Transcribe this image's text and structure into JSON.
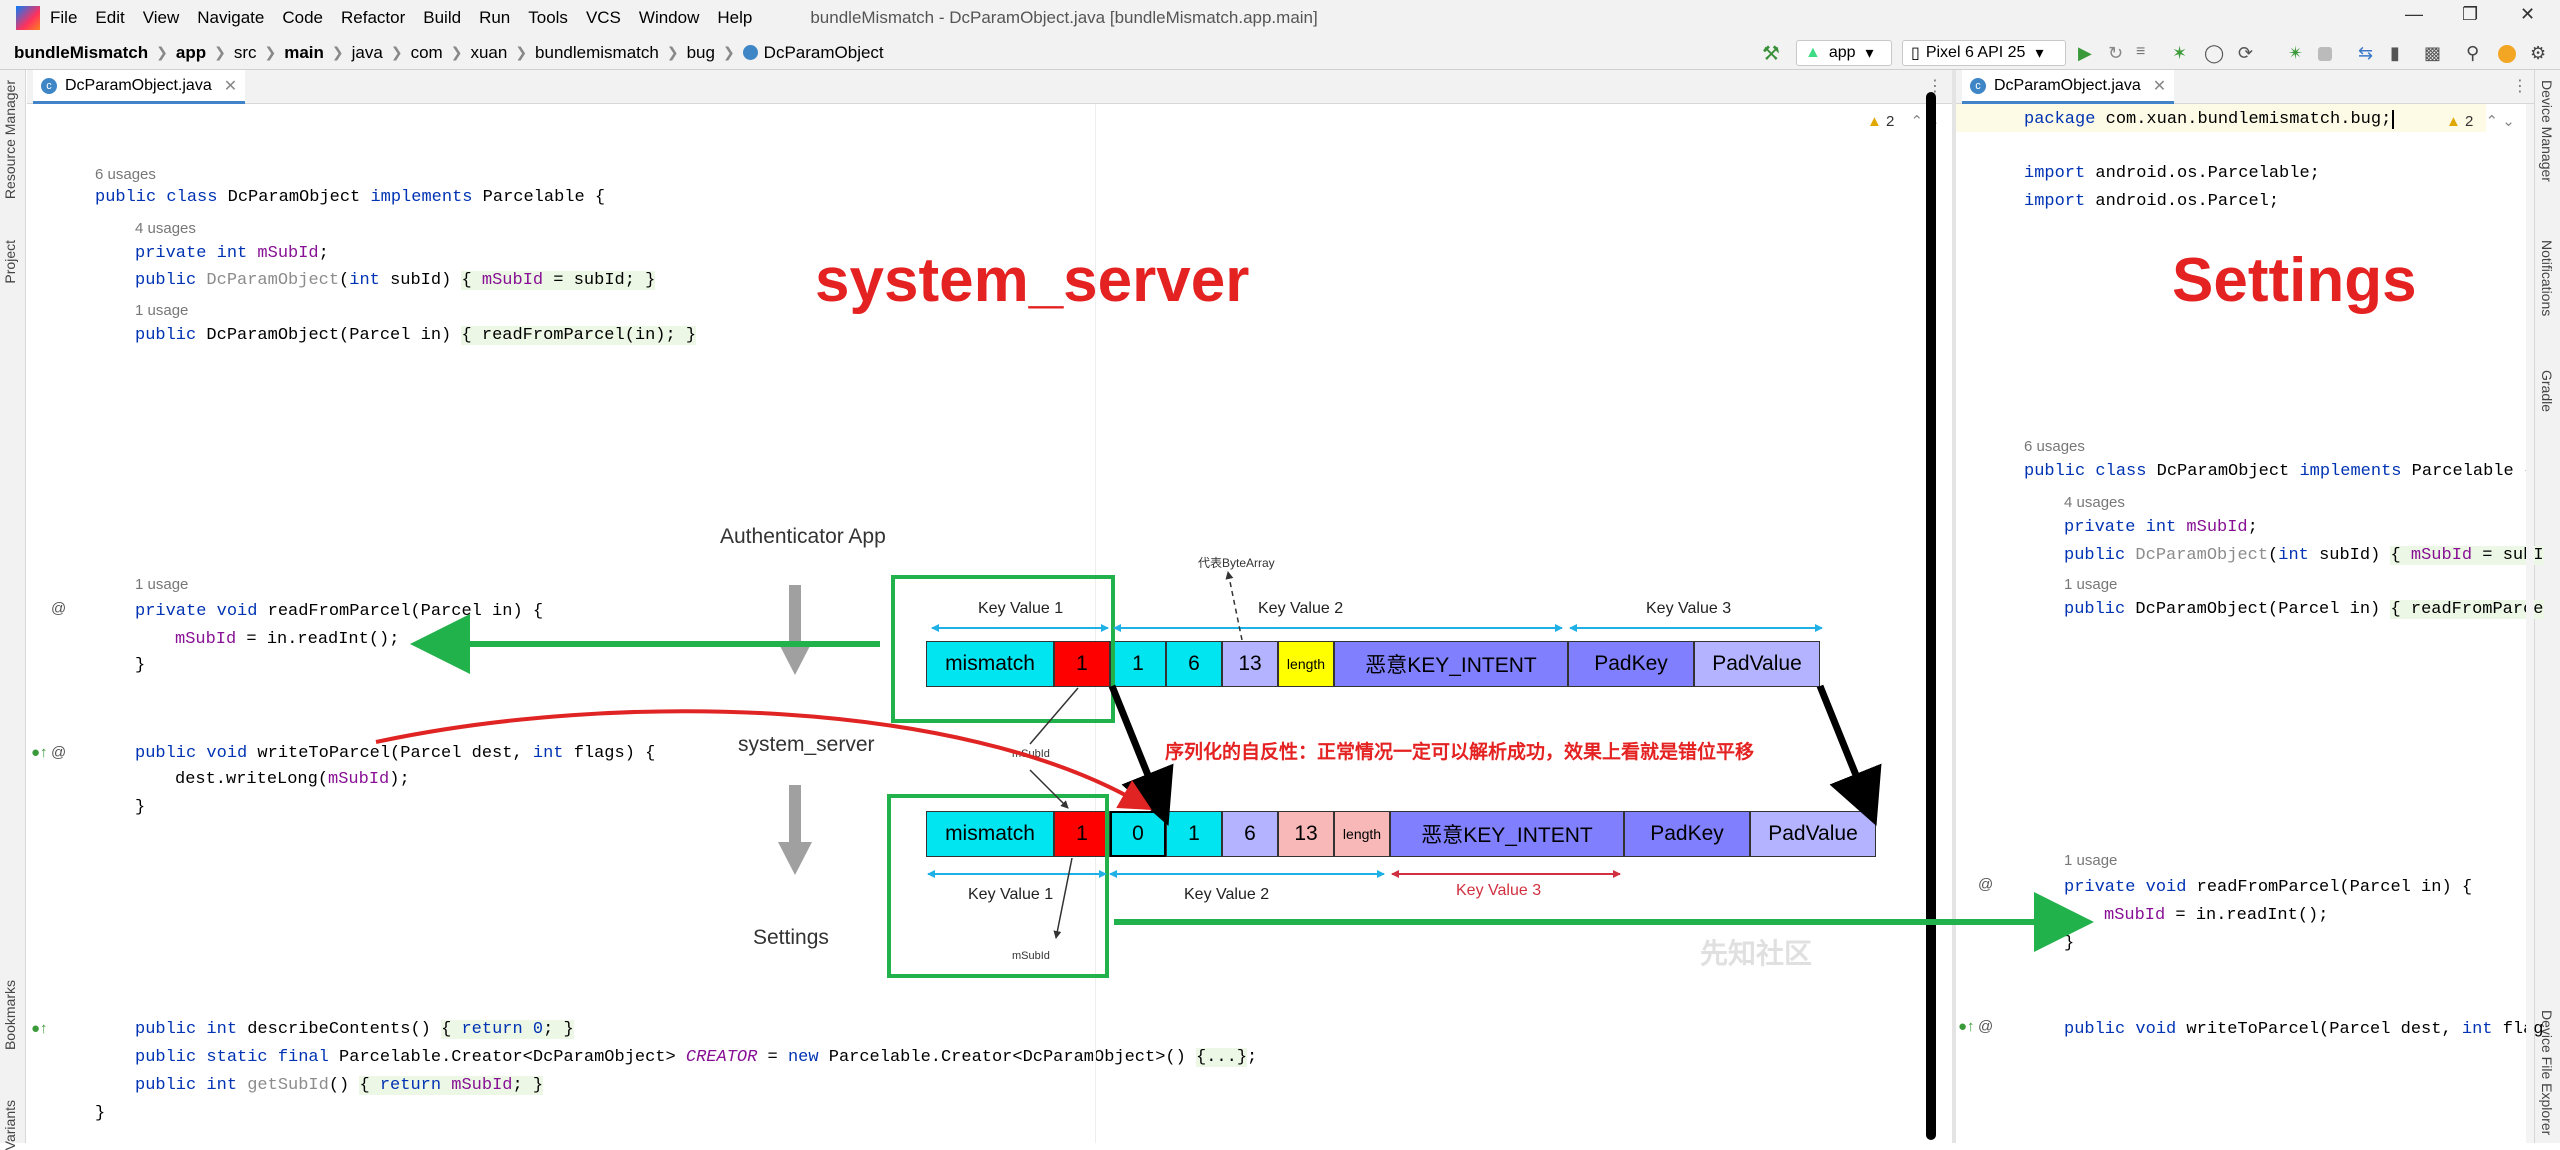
{
  "menubar": {
    "items": [
      "File",
      "Edit",
      "View",
      "Navigate",
      "Code",
      "Refactor",
      "Build",
      "Run",
      "Tools",
      "VCS",
      "Window",
      "Help"
    ],
    "title": "bundleMismatch - DcParamObject.java [bundleMismatch.app.main]"
  },
  "navbar": {
    "crumbs": [
      "bundleMismatch",
      "app",
      "src",
      "main",
      "java",
      "com",
      "xuan",
      "bundlemismatch",
      "bug",
      "DcParamObject"
    ],
    "run_config": "app",
    "device": "Pixel 6 API 25"
  },
  "left_strip": {
    "resource_manager": "Resource Manager",
    "project": "Project",
    "bookmarks": "Bookmarks",
    "variants": "Variants"
  },
  "right_strip": {
    "device_manager": "Device Manager",
    "notifications": "Notifications",
    "gradle": "Gradle",
    "device_file_explorer": "Device File Explorer"
  },
  "tabs": {
    "left": "DcParamObject.java",
    "right": "DcParamObject.java"
  },
  "warnings": {
    "left": "2",
    "right": "2"
  },
  "left_code": {
    "usages_6": "6 usages",
    "usages_4": "4 usages",
    "usages_1a": "1 usage",
    "usages_1b": "1 usage",
    "l_class_kw": "public class ",
    "l_class_name": "DcParamObject ",
    "l_class_impl": "implements ",
    "l_class_rest": "Parcelable {",
    "l_field_kw": "private int ",
    "l_field_name": "mSubId",
    ";": ";",
    "l_ctor1_kw": "public ",
    "l_ctor1_name": "DcParamObject",
    "l_ctor1_p": "(",
    "l_ctor1_int": "int ",
    "l_ctor1_rest": "subId) ",
    "l_ctor1_body": "{ ",
    "l_ctor1_fld": "mSubId",
    " l_ctor1_tail": " = subId; }",
    "l_ctor2_kw": "public ",
    "l_ctor2_rest": "DcParamObject(Parcel in) ",
    "l_ctor2_body": "{ readFromParcel(in); }",
    "l_read_kw": "private void ",
    "l_read_rest": "readFromParcel(Parcel in) {",
    "l_read_body_fld": "mSubId",
    "l_read_body_rest": " = in.readInt();",
    "close": "}",
    "l_write_kw": "public void ",
    "l_write_rest": "writeToParcel(Parcel dest, ",
    "l_write_int": "int ",
    "l_write_tail": "flags) {",
    "l_write_body": "dest.writeLong(",
    "l_write_body_fld": "mSubId",
    "l_write_body_tail": ");",
    "l_desc_kw": "public int ",
    "l_desc_rest": "describeContents() ",
    "l_desc_body": "{ ",
    "l_desc_ret": "return ",
    "l_desc_num": "0",
    "l_desc_tail": "; }",
    "l_creator_kw": "public static final ",
    "l_creator_type": "Parcelable.Creator<DcParamObject> ",
    "l_creator_name": "CREATOR",
    " l_creator_eq": " = ",
    "l_creator_new": "new ",
    "l_creator_rest": "Parcelable.Creator<DcParamObject>() ",
    "l_creator_fold": "{...}",
    "l_creator_tail": ";",
    "l_get_kw": "public int ",
    "l_get_name": "getSubId",
    "l_get_p": "() ",
    "l_get_body": "{ ",
    "l_get_ret": "return ",
    "l_get_fld": "mSubId",
    "l_get_tail": "; }",
    "last": "}"
  },
  "right_code": {
    "package_kw": "package ",
    "package_rest": "com.xuan.bundlemismatch.bug;",
    "import1_kw": "import ",
    "import1_rest": "android.os.Parcelable;",
    "import2_kw": "import ",
    "import2_rest": "android.os.Parcel;",
    "usages_6": "6 usages",
    "usages_4": "4 usages",
    "usages_1a": "1 usage",
    "usages_1b": "1 usage",
    "class_kw": "public class ",
    "class_rest": "DcParamObject ",
    "class_impl": "implements ",
    "class_tail": "Parcelable {",
    "field_kw": "private int ",
    "field_name": "mSubId",
    "field_tail": ";",
    "ctor1_kw": "public ",
    "ctor1_name": "DcParamObject",
    "ctor1_p": "(",
    "ctor1_int": "int ",
    "ctor1_rest": "subId) ",
    "ctor1_body": "{ ",
    "ctor1_fld": "mSubId",
    "ctor1_tail": " = subI",
    "ctor2_kw": "public ",
    "ctor2_rest": "DcParamObject(Parcel in) ",
    "ctor2_body": "{ readFromParce",
    "read_kw": "private void ",
    "read_rest": "readFromParcel(Parcel in) {",
    "read_fld": "mSubId",
    "read_tail": " = in.readInt();",
    "close": "}",
    "write_kw": "public void ",
    "write_rest": "writeToParcel(Parcel dest, ",
    "write_int": "int ",
    "write_tail": "flag"
  },
  "overlay": {
    "system_server_title": "system_server",
    "settings_title": "Settings",
    "authenticator_app": "Authenticator App",
    "system_server_label": "system_server",
    "settings_label": "Settings",
    "bytearray_note": "代表ByteArray",
    "msubid_mid": "mSubId",
    "msubid_bottom": "mSubId",
    "caption": "序列化的自反性：正常情况一定可以解析成功，效果上看就是错位平移",
    "watermark": "先知社区",
    "row1": {
      "kv1": "Key Value 1",
      "kv2": "Key Value 2",
      "kv3": "Key Value 3",
      "cells": [
        "mismatch",
        "1",
        "1",
        "6",
        "13",
        "length",
        "恶意KEY_INTENT",
        "PadKey",
        "PadValue"
      ]
    },
    "row2": {
      "kv1": "Key Value 1",
      "kv2": "Key Value 2",
      "kv3": "Key Value 3",
      "cells": [
        "mismatch",
        "1",
        "0",
        "1",
        "6",
        "13",
        "length",
        "恶意KEY_INTENT",
        "PadKey",
        "PadValue"
      ]
    }
  },
  "colors": {
    "cyan": "#00e5ef",
    "red": "#ff0000",
    "lavender": "#b3b3ff",
    "yellow": "#ffff00",
    "pink": "#f8b8b8",
    "violet": "#8080ff",
    "green": "#21b24b",
    "arrowred": "#e02424"
  }
}
